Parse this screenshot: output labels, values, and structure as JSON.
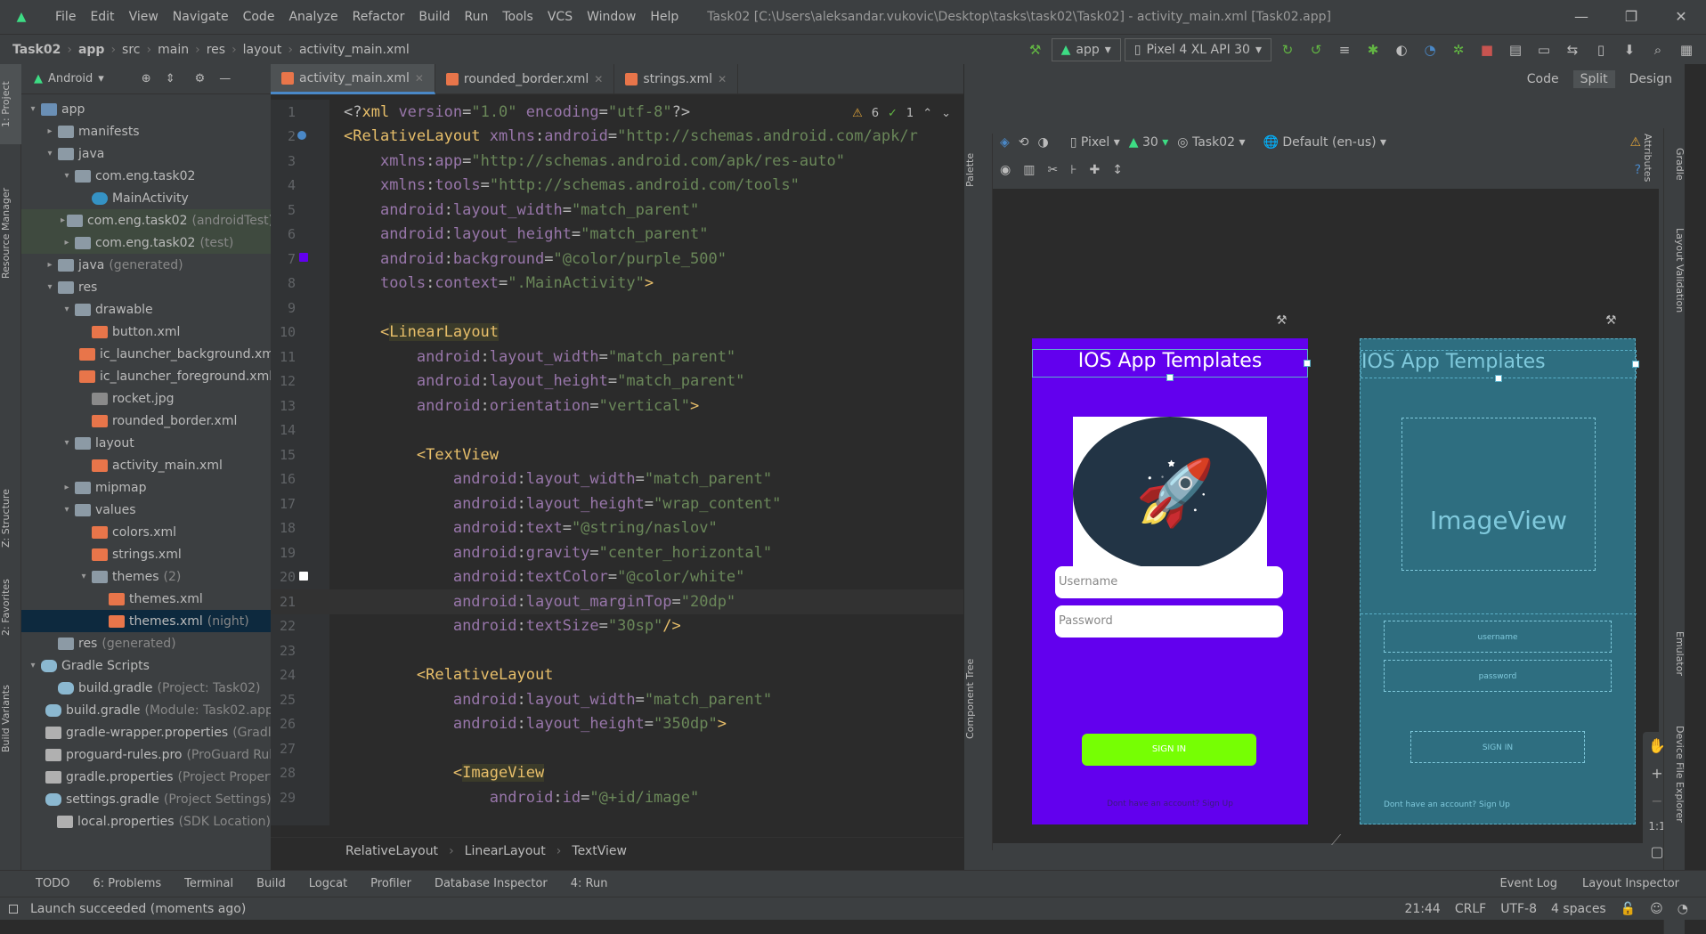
{
  "titlebar": {
    "menu": [
      "File",
      "Edit",
      "View",
      "Navigate",
      "Code",
      "Analyze",
      "Refactor",
      "Build",
      "Run",
      "Tools",
      "VCS",
      "Window",
      "Help"
    ],
    "window_title": "Task02 [C:\\Users\\aleksandar.vukovic\\Desktop\\tasks\\task02\\Task02] - activity_main.xml [Task02.app]"
  },
  "navbar": {
    "crumbs": [
      "Task02",
      "app",
      "src",
      "main",
      "res",
      "layout",
      "activity_main.xml"
    ],
    "run_config": "app",
    "device": "Pixel 4 XL API 30"
  },
  "project": {
    "view": "Android",
    "tree": [
      {
        "label": "app",
        "depth": 0,
        "arrow": "▾",
        "icon": "folder blue"
      },
      {
        "label": "manifests",
        "depth": 1,
        "arrow": "▸",
        "icon": "folder"
      },
      {
        "label": "java",
        "depth": 1,
        "arrow": "▾",
        "icon": "folder"
      },
      {
        "label": "com.eng.task02",
        "depth": 2,
        "arrow": "▾",
        "icon": "folder"
      },
      {
        "label": "MainActivity",
        "depth": 3,
        "arrow": "",
        "icon": "cls"
      },
      {
        "label": "com.eng.task02",
        "sub": "(androidTest)",
        "depth": 2,
        "arrow": "▸",
        "icon": "folder",
        "hl": true
      },
      {
        "label": "com.eng.task02",
        "sub": "(test)",
        "depth": 2,
        "arrow": "▸",
        "icon": "folder",
        "hl": true
      },
      {
        "label": "java",
        "sub": "(generated)",
        "depth": 1,
        "arrow": "▸",
        "icon": "folder"
      },
      {
        "label": "res",
        "depth": 1,
        "arrow": "▾",
        "icon": "folder"
      },
      {
        "label": "drawable",
        "depth": 2,
        "arrow": "▾",
        "icon": "folder"
      },
      {
        "label": "button.xml",
        "depth": 3,
        "arrow": "",
        "icon": "xml"
      },
      {
        "label": "ic_launcher_background.xml",
        "depth": 3,
        "arrow": "",
        "icon": "xml"
      },
      {
        "label": "ic_launcher_foreground.xml",
        "depth": 3,
        "arrow": "",
        "icon": "xml"
      },
      {
        "label": "rocket.jpg",
        "depth": 3,
        "arrow": "",
        "icon": "img"
      },
      {
        "label": "rounded_border.xml",
        "depth": 3,
        "arrow": "",
        "icon": "xml"
      },
      {
        "label": "layout",
        "depth": 2,
        "arrow": "▾",
        "icon": "folder"
      },
      {
        "label": "activity_main.xml",
        "depth": 3,
        "arrow": "",
        "icon": "xml"
      },
      {
        "label": "mipmap",
        "depth": 2,
        "arrow": "▸",
        "icon": "folder"
      },
      {
        "label": "values",
        "depth": 2,
        "arrow": "▾",
        "icon": "folder"
      },
      {
        "label": "colors.xml",
        "depth": 3,
        "arrow": "",
        "icon": "xml"
      },
      {
        "label": "strings.xml",
        "depth": 3,
        "arrow": "",
        "icon": "xml"
      },
      {
        "label": "themes",
        "sub": "(2)",
        "depth": 3,
        "arrow": "▾",
        "icon": "folder"
      },
      {
        "label": "themes.xml",
        "depth": 4,
        "arrow": "",
        "icon": "xml"
      },
      {
        "label": "themes.xml",
        "sub": "(night)",
        "depth": 4,
        "arrow": "",
        "icon": "xml",
        "sel": true
      },
      {
        "label": "res",
        "sub": "(generated)",
        "depth": 1,
        "arrow": "",
        "icon": "folder"
      },
      {
        "label": "Gradle Scripts",
        "depth": 0,
        "arrow": "▾",
        "icon": "gradle"
      },
      {
        "label": "build.gradle",
        "sub": "(Project: Task02)",
        "depth": 1,
        "arrow": "",
        "icon": "gradle"
      },
      {
        "label": "build.gradle",
        "sub": "(Module: Task02.app)",
        "depth": 1,
        "arrow": "",
        "icon": "gradle"
      },
      {
        "label": "gradle-wrapper.properties",
        "sub": "(Gradle Version)",
        "depth": 1,
        "arrow": "",
        "icon": "prop"
      },
      {
        "label": "proguard-rules.pro",
        "sub": "(ProGuard Rules)",
        "depth": 1,
        "arrow": "",
        "icon": "prop"
      },
      {
        "label": "gradle.properties",
        "sub": "(Project Properties)",
        "depth": 1,
        "arrow": "",
        "icon": "prop"
      },
      {
        "label": "settings.gradle",
        "sub": "(Project Settings)",
        "depth": 1,
        "arrow": "",
        "icon": "gradle"
      },
      {
        "label": "local.properties",
        "sub": "(SDK Location)",
        "depth": 1,
        "arrow": "",
        "icon": "prop"
      }
    ]
  },
  "editor": {
    "tabs": [
      {
        "label": "activity_main.xml",
        "active": true
      },
      {
        "label": "rounded_border.xml",
        "active": false
      },
      {
        "label": "strings.xml",
        "active": false
      }
    ],
    "warnings": "6",
    "checks": "1",
    "breadcrumbs": [
      "RelativeLayout",
      "LinearLayout",
      "TextView"
    ],
    "lines": [
      [
        [
          "p",
          "<?"
        ],
        [
          "t",
          "xml "
        ],
        [
          "a",
          "version"
        ],
        [
          "p",
          "="
        ],
        [
          "v",
          "\"1.0\""
        ],
        [
          "p",
          " "
        ],
        [
          "a",
          "encoding"
        ],
        [
          "p",
          "="
        ],
        [
          "v",
          "\"utf-8\""
        ],
        [
          "p",
          "?>"
        ]
      ],
      [
        [
          "t",
          "<RelativeLayout "
        ],
        [
          "a",
          "xmlns"
        ],
        [
          "p",
          ":"
        ],
        [
          "a",
          "android"
        ],
        [
          "p",
          "="
        ],
        [
          "v",
          "\"http://schemas.android.com/apk/r"
        ]
      ],
      [
        [
          "p",
          "    "
        ],
        [
          "a",
          "xmlns"
        ],
        [
          "p",
          ":"
        ],
        [
          "a",
          "app"
        ],
        [
          "p",
          "="
        ],
        [
          "v",
          "\"http://schemas.android.com/apk/res-auto\""
        ]
      ],
      [
        [
          "p",
          "    "
        ],
        [
          "a",
          "xmlns"
        ],
        [
          "p",
          ":"
        ],
        [
          "a",
          "tools"
        ],
        [
          "p",
          "="
        ],
        [
          "v",
          "\"http://schemas.android.com/tools\""
        ]
      ],
      [
        [
          "p",
          "    "
        ],
        [
          "a",
          "android"
        ],
        [
          "p",
          ":"
        ],
        [
          "a",
          "layout_width"
        ],
        [
          "p",
          "="
        ],
        [
          "v",
          "\"match_parent\""
        ]
      ],
      [
        [
          "p",
          "    "
        ],
        [
          "a",
          "android"
        ],
        [
          "p",
          ":"
        ],
        [
          "a",
          "layout_height"
        ],
        [
          "p",
          "="
        ],
        [
          "v",
          "\"match_parent\""
        ]
      ],
      [
        [
          "p",
          "    "
        ],
        [
          "a",
          "android"
        ],
        [
          "p",
          ":"
        ],
        [
          "a",
          "background"
        ],
        [
          "p",
          "="
        ],
        [
          "v",
          "\"@color/purple_500\""
        ]
      ],
      [
        [
          "p",
          "    "
        ],
        [
          "a",
          "tools"
        ],
        [
          "p",
          ":"
        ],
        [
          "a",
          "context"
        ],
        [
          "p",
          "="
        ],
        [
          "v",
          "\".MainActivity\""
        ],
        [
          "t",
          ">"
        ]
      ],
      [
        [
          "p",
          ""
        ]
      ],
      [
        [
          "p",
          "    "
        ],
        [
          "t",
          "<"
        ],
        [
          "h",
          "LinearLayout"
        ]
      ],
      [
        [
          "p",
          "        "
        ],
        [
          "a",
          "android"
        ],
        [
          "p",
          ":"
        ],
        [
          "a",
          "layout_width"
        ],
        [
          "p",
          "="
        ],
        [
          "v",
          "\"match_parent\""
        ]
      ],
      [
        [
          "p",
          "        "
        ],
        [
          "a",
          "android"
        ],
        [
          "p",
          ":"
        ],
        [
          "a",
          "layout_height"
        ],
        [
          "p",
          "="
        ],
        [
          "v",
          "\"match_parent\""
        ]
      ],
      [
        [
          "p",
          "        "
        ],
        [
          "a",
          "android"
        ],
        [
          "p",
          ":"
        ],
        [
          "a",
          "orientation"
        ],
        [
          "p",
          "="
        ],
        [
          "v",
          "\"vertical\""
        ],
        [
          "t",
          ">"
        ]
      ],
      [
        [
          "p",
          ""
        ]
      ],
      [
        [
          "p",
          "        "
        ],
        [
          "t",
          "<TextView"
        ]
      ],
      [
        [
          "p",
          "            "
        ],
        [
          "a",
          "android"
        ],
        [
          "p",
          ":"
        ],
        [
          "a",
          "layout_width"
        ],
        [
          "p",
          "="
        ],
        [
          "v",
          "\"match_parent\""
        ]
      ],
      [
        [
          "p",
          "            "
        ],
        [
          "a",
          "android"
        ],
        [
          "p",
          ":"
        ],
        [
          "a",
          "layout_height"
        ],
        [
          "p",
          "="
        ],
        [
          "v",
          "\"wrap_content\""
        ]
      ],
      [
        [
          "p",
          "            "
        ],
        [
          "a",
          "android"
        ],
        [
          "p",
          ":"
        ],
        [
          "a",
          "text"
        ],
        [
          "p",
          "="
        ],
        [
          "v",
          "\"@string/naslov\""
        ]
      ],
      [
        [
          "p",
          "            "
        ],
        [
          "a",
          "android"
        ],
        [
          "p",
          ":"
        ],
        [
          "a",
          "gravity"
        ],
        [
          "p",
          "="
        ],
        [
          "v",
          "\"center_horizontal\""
        ]
      ],
      [
        [
          "p",
          "            "
        ],
        [
          "a",
          "android"
        ],
        [
          "p",
          ":"
        ],
        [
          "a",
          "textColor"
        ],
        [
          "p",
          "="
        ],
        [
          "v",
          "\"@color/white\""
        ]
      ],
      [
        [
          "p",
          "            "
        ],
        [
          "a",
          "android"
        ],
        [
          "p",
          ":"
        ],
        [
          "a",
          "layout_marginTop"
        ],
        [
          "p",
          "="
        ],
        [
          "v",
          "\"20dp\""
        ]
      ],
      [
        [
          "p",
          "            "
        ],
        [
          "a",
          "android"
        ],
        [
          "p",
          ":"
        ],
        [
          "a",
          "textSize"
        ],
        [
          "p",
          "="
        ],
        [
          "v",
          "\"30sp\""
        ],
        [
          "t",
          "/>"
        ]
      ],
      [
        [
          "p",
          ""
        ]
      ],
      [
        [
          "p",
          "        "
        ],
        [
          "t",
          "<RelativeLayout"
        ]
      ],
      [
        [
          "p",
          "            "
        ],
        [
          "a",
          "android"
        ],
        [
          "p",
          ":"
        ],
        [
          "a",
          "layout_width"
        ],
        [
          "p",
          "="
        ],
        [
          "v",
          "\"match_parent\""
        ]
      ],
      [
        [
          "p",
          "            "
        ],
        [
          "a",
          "android"
        ],
        [
          "p",
          ":"
        ],
        [
          "a",
          "layout_height"
        ],
        [
          "p",
          "="
        ],
        [
          "v",
          "\"350dp\""
        ],
        [
          "t",
          ">"
        ]
      ],
      [
        [
          "p",
          ""
        ]
      ],
      [
        [
          "p",
          "            "
        ],
        [
          "t",
          "<"
        ],
        [
          "h",
          "ImageView"
        ]
      ],
      [
        [
          "p",
          "                "
        ],
        [
          "a",
          "android"
        ],
        [
          "p",
          ":"
        ],
        [
          "a",
          "id"
        ],
        [
          "p",
          "="
        ],
        [
          "v",
          "\"@+id/image\""
        ]
      ]
    ]
  },
  "design": {
    "modes": [
      "Code",
      "Split",
      "Design"
    ],
    "active_mode": "Split",
    "palette_label": "Palette",
    "component_tree_label": "Component Tree",
    "device": "Pixel",
    "api": "30",
    "theme": "Task02",
    "locale": "Default (en-us)",
    "preview": {
      "title": "IOS App Templates",
      "username_hint": "Username",
      "password_hint": "Password",
      "signin": "SIGN IN",
      "signup": "Dont have an account? Sign Up",
      "bg_color": "#6200ee",
      "button_color": "#76ff03"
    },
    "blueprint": {
      "title": "IOS App Templates",
      "imageview": "ImageView",
      "username": "username",
      "password": "password",
      "signin": "SIGN IN",
      "signup": "Dont have an account? Sign Up"
    },
    "zoom_fit": "1:1"
  },
  "bottomtools": {
    "left": [
      "TODO",
      "6: Problems",
      "Terminal",
      "Build",
      "Logcat",
      "Profiler",
      "Database Inspector",
      "4: Run"
    ],
    "right": [
      "Event Log",
      "Layout Inspector"
    ]
  },
  "status": {
    "message": "Launch succeeded (moments ago)",
    "position": "21:44",
    "line_sep": "CRLF",
    "encoding": "UTF-8",
    "indent": "4 spaces"
  },
  "side_labels": {
    "left": [
      "1: Project",
      "Resource Manager",
      "Z: Structure",
      "2: Favorites",
      "Build Variants"
    ],
    "right": [
      "Gradle",
      "Layout Validation",
      "Attributes",
      "Emulator",
      "Device File Explorer"
    ]
  },
  "colors": {
    "accent": "#4a88c7",
    "selection": "#0d293e"
  }
}
